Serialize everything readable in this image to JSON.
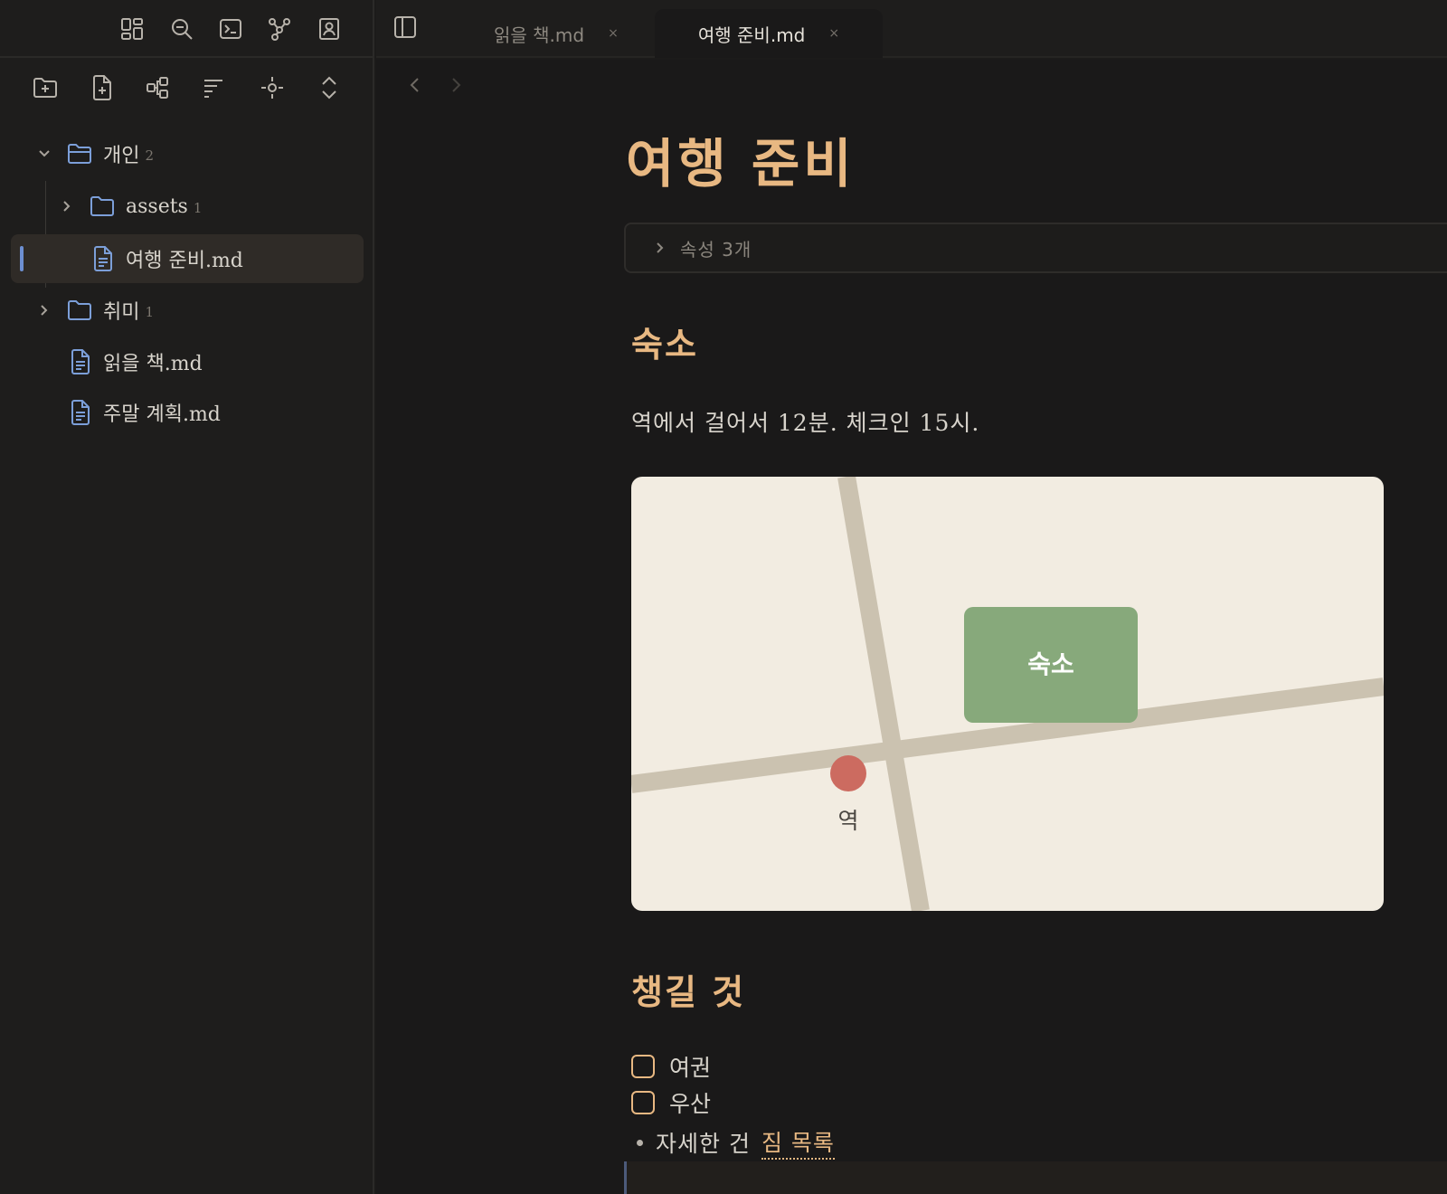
{
  "tabs": [
    {
      "label": "읽을 책.md",
      "close": "×",
      "active": false
    },
    {
      "label": "여행 준비.md",
      "close": "×",
      "active": true
    }
  ],
  "sidebar": {
    "ribbon_icons": [
      "dashboard-icon",
      "search-icon",
      "terminal-icon",
      "graph-icon",
      "contact-icon"
    ],
    "toolbar_icons": [
      "new-folder-icon",
      "new-note-icon",
      "canvas-icon",
      "sort-icon",
      "reveal-icon",
      "collapse-icon"
    ],
    "tree": [
      {
        "label": "개인",
        "count": "2",
        "type": "folder",
        "expanded": true
      },
      {
        "label": "assets",
        "count": "1",
        "type": "folder",
        "expanded": false
      },
      {
        "label": "여행 준비.md",
        "type": "file",
        "active": true
      },
      {
        "label": "취미",
        "count": "1",
        "type": "folder",
        "expanded": false
      },
      {
        "label": "읽을 책.md",
        "type": "file"
      },
      {
        "label": "주말 계획.md",
        "type": "file"
      }
    ]
  },
  "note": {
    "title": "여행 준비",
    "properties_label": "속성  3개",
    "section1": "숙소",
    "paragraph": "역에서 걸어서 12분. 체크인 15시.",
    "map": {
      "lodging_label": "숙소",
      "station_label": "역",
      "lodging_color": "#87a97b",
      "station_color": "#cc6b60",
      "road_color": "#cbc2b0",
      "bg_color": "#f2ece1"
    },
    "section2": "챙길 것",
    "tasks": [
      {
        "label": "여권",
        "checked": false
      },
      {
        "label": "우산",
        "checked": false
      }
    ],
    "bullet_text": "자세한 건",
    "bullet_link": "짐 목록"
  },
  "colors": {
    "accent": "#e8b882",
    "link_folder": "#7c9fd9",
    "active_bg": "#2f2b27"
  }
}
